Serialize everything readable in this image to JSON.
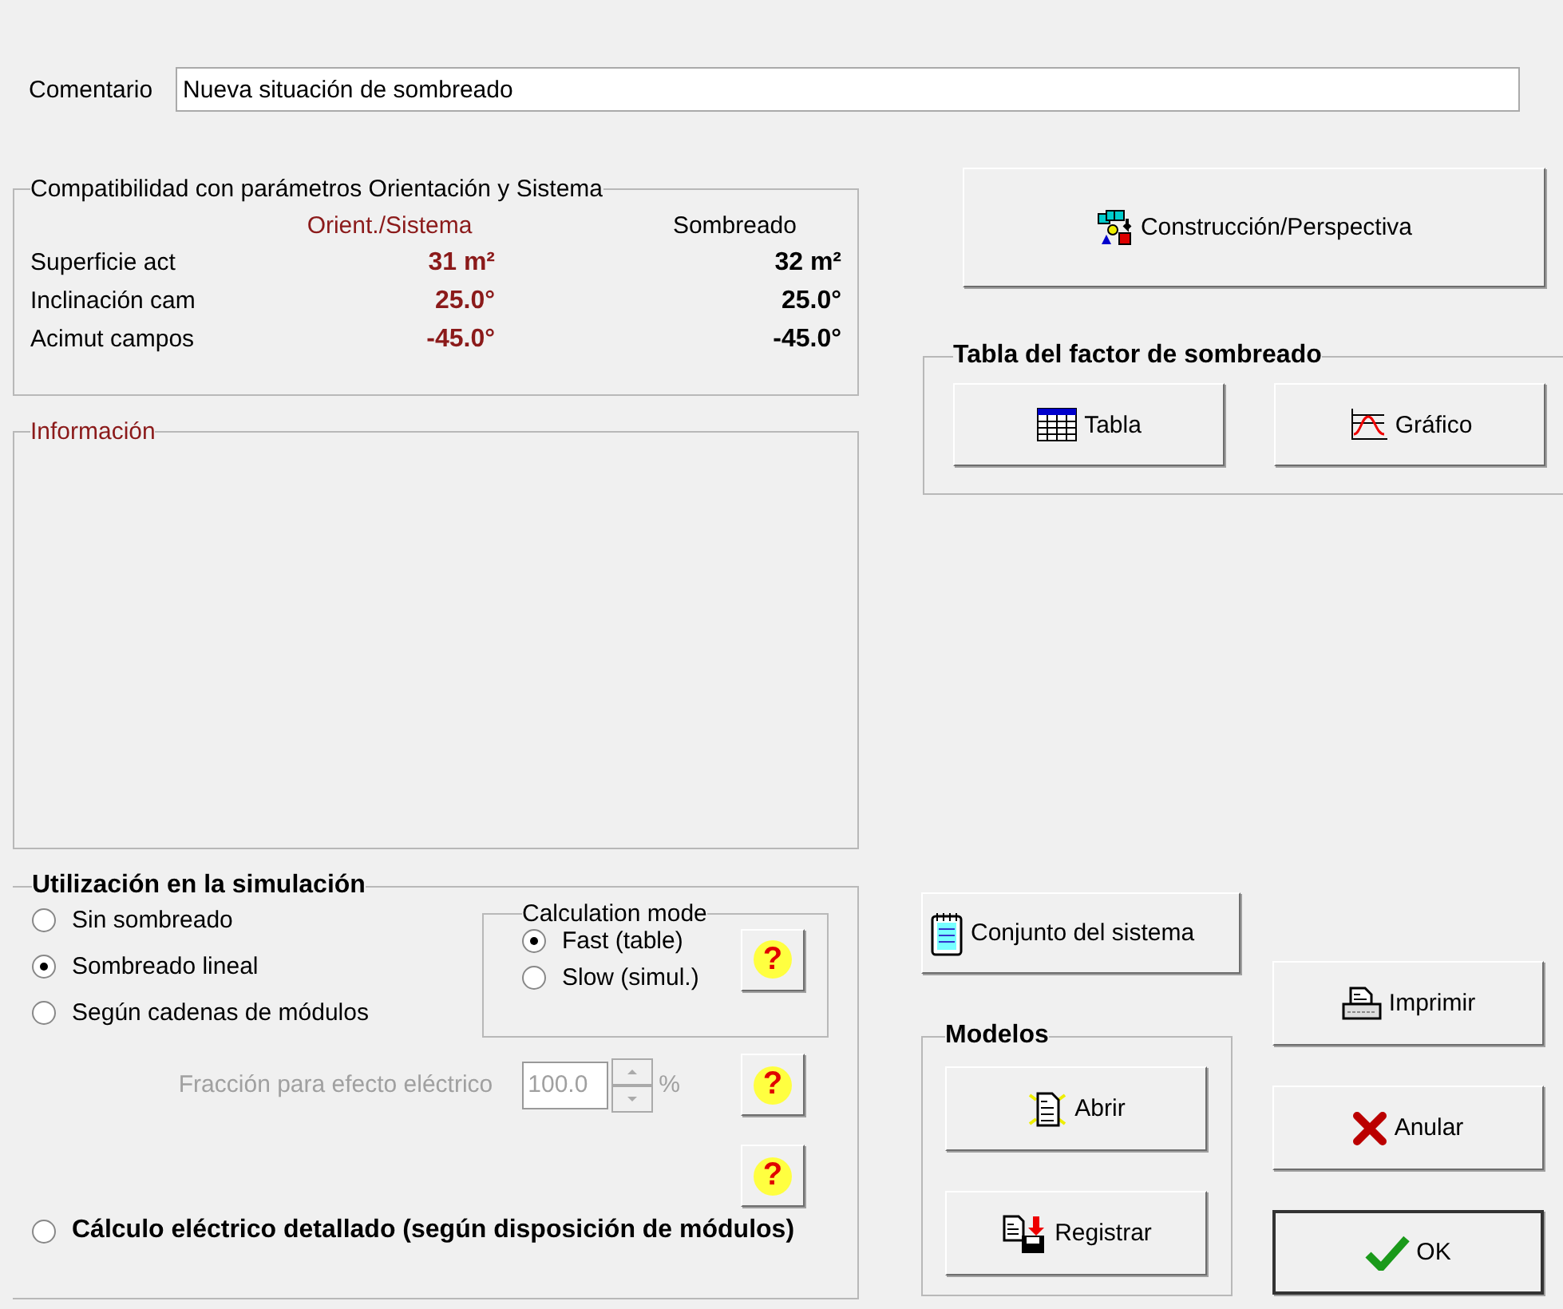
{
  "comment": {
    "label": "Comentario",
    "value": "Nueva situación de sombreado"
  },
  "compatibility": {
    "title": "Compatibilidad con parámetros Orientación y Sistema",
    "columns": [
      "Orient./Sistema",
      "Sombreado"
    ],
    "rows": [
      {
        "label": "Superficie act",
        "orient": "31 m²",
        "shading": "32 m²"
      },
      {
        "label": "Inclinación cam",
        "orient": "25.0°",
        "shading": "25.0°"
      },
      {
        "label": "Acimut campos",
        "orient": "-45.0°",
        "shading": "-45.0°"
      }
    ]
  },
  "information": {
    "title": "Información"
  },
  "simulation": {
    "title": "Utilización en la simulación",
    "options": [
      {
        "label": "Sin sombreado",
        "selected": false
      },
      {
        "label": "Sombreado lineal",
        "selected": true
      },
      {
        "label": "Según cadenas de módulos",
        "selected": false
      }
    ],
    "calculation_mode": {
      "title": "Calculation mode",
      "options": [
        {
          "label": "Fast (table)",
          "selected": true
        },
        {
          "label": "Slow (simul.)",
          "selected": false
        }
      ],
      "help": "?"
    },
    "fraction": {
      "label": "Fracción para efecto eléctrico",
      "value": "100.0",
      "unit": "%",
      "disabled": true,
      "help": "?"
    },
    "extra_help": "?",
    "detailed": {
      "label": "Cálculo eléctrico detallado (según disposición de módulos)",
      "selected": false
    }
  },
  "construction_button": "Construcción/Perspectiva",
  "shading_table": {
    "title": "Tabla del factor de sombreado",
    "buttons": [
      "Tabla",
      "Gráfico"
    ]
  },
  "system_button": "Conjunto del sistema",
  "models": {
    "title": "Modelos",
    "buttons": [
      "Abrir",
      "Registrar"
    ]
  },
  "actions": [
    {
      "label": "Imprimir",
      "default": false
    },
    {
      "label": "Anular",
      "default": false
    },
    {
      "label": "OK",
      "default": true
    }
  ]
}
